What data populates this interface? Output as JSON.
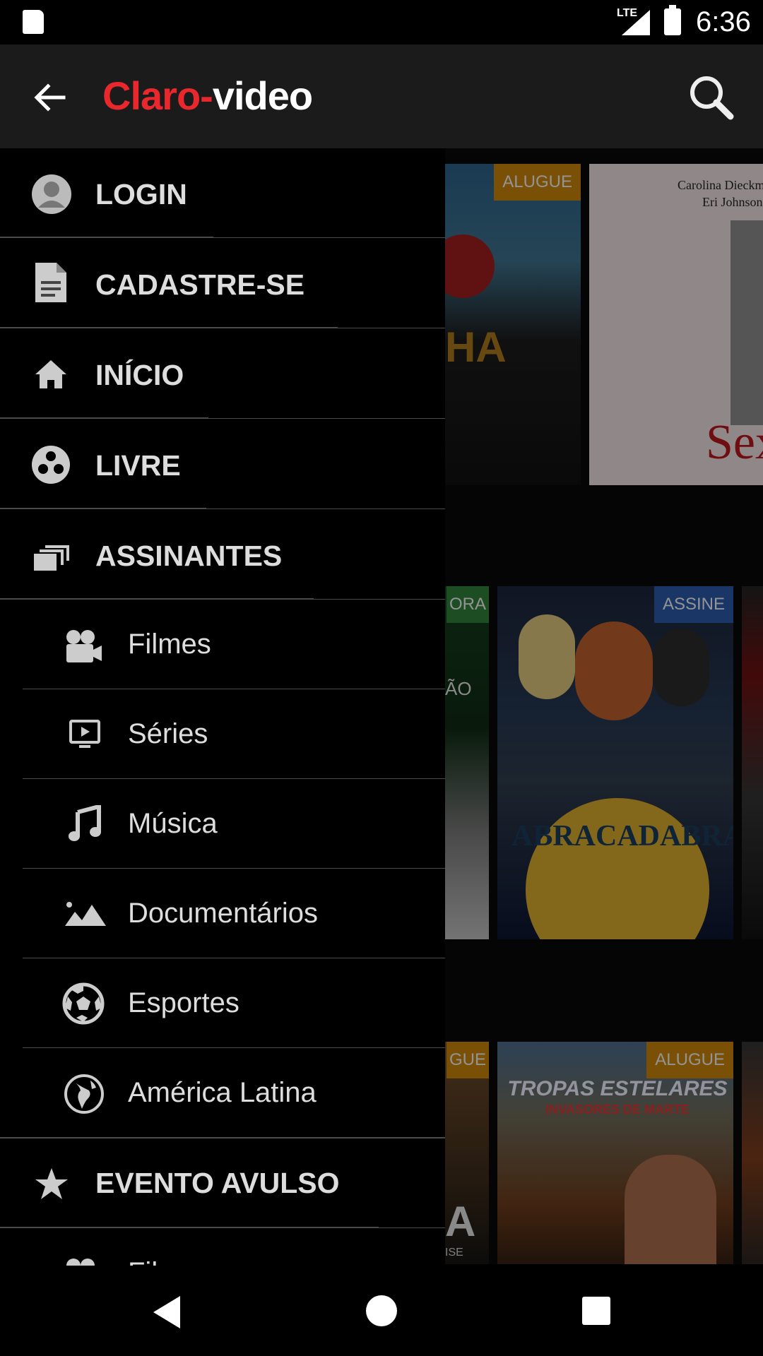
{
  "status_bar": {
    "network": "LTE",
    "time": "6:36"
  },
  "app_bar": {
    "logo_part1": "Claro",
    "logo_part2": "video"
  },
  "drawer": {
    "main_items": [
      {
        "label": "LOGIN",
        "icon": "avatar-icon"
      },
      {
        "label": "CADASTRE-SE",
        "icon": "document-icon"
      },
      {
        "label": "INÍCIO",
        "icon": "home-icon"
      },
      {
        "label": "LIVRE",
        "icon": "free-icon"
      },
      {
        "label": "ASSINANTES",
        "icon": "subscribers-icon"
      }
    ],
    "sub_items": [
      {
        "label": "Filmes",
        "icon": "video-camera-icon"
      },
      {
        "label": "Séries",
        "icon": "tv-icon"
      },
      {
        "label": "Música",
        "icon": "music-note-icon"
      },
      {
        "label": "Documentários",
        "icon": "landscape-icon"
      },
      {
        "label": "Esportes",
        "icon": "soccer-ball-icon"
      },
      {
        "label": "América Latina",
        "icon": "globe-icon"
      }
    ],
    "event_item": {
      "label": "EVENTO AVULSO",
      "icon": "star-icon"
    },
    "partial_item": {
      "label": "Filmes",
      "icon": "video-camera-icon"
    }
  },
  "content": {
    "row1": {
      "badge": "ALUGUE",
      "poster2_text1": "Carolina Dieckm",
      "poster2_text2": "Eri Johnson",
      "poster2_title": "Sex",
      "poster1_text": "HA"
    },
    "row2": {
      "left_badge": "ORA",
      "left_text": "ÃO",
      "badge": "ASSINE",
      "title": "ABRACADABRA"
    },
    "row3": {
      "left_badge": "GUE",
      "badge": "ALUGUE",
      "title": "TROPAS ESTELARES",
      "subtitle": "INVASORES DE MARTE",
      "left_text": "A",
      "left_sub": "ISE"
    }
  },
  "colors": {
    "brand_red": "#e8282d",
    "alugue": "#c3820a",
    "assine": "#2a58a7",
    "agora": "#2f7d38"
  }
}
